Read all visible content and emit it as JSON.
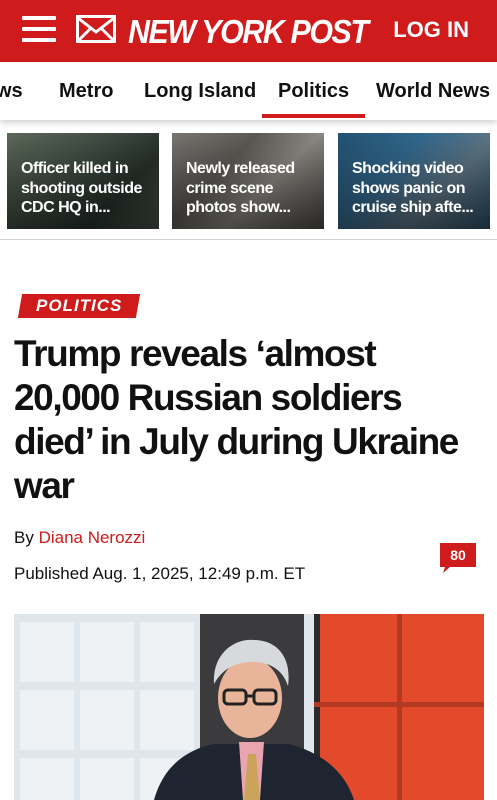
{
  "header": {
    "logo_text": "NEW YORK POST",
    "login_label": "LOG IN",
    "menu_icon": "hamburger-menu-icon",
    "mail_icon": "envelope-icon",
    "brand_color": "#cf1b1b"
  },
  "nav": {
    "items": [
      {
        "label": "World News"
      },
      {
        "label": "Metro"
      },
      {
        "label": "Long Island"
      },
      {
        "label": "Politics"
      },
      {
        "label": "World News"
      }
    ],
    "partial_first": "ws",
    "active": "Politics"
  },
  "stories": [
    {
      "caption": "Officer killed in shooting outside CDC HQ in..."
    },
    {
      "caption": "Newly released crime scene photos show..."
    },
    {
      "caption": "Shocking video shows panic on cruise ship afte..."
    }
  ],
  "article": {
    "section_tag": "POLITICS",
    "headline": "Trump reveals ‘almost 20,000 Russian soldiers died’ in July during Ukraine war",
    "by_prefix": "By ",
    "author": "Diana Nerozzi",
    "published": "Published Aug. 1, 2025, 12:49 p.m. ET",
    "comment_count": "80",
    "comment_icon": "comment-bubble-icon"
  }
}
